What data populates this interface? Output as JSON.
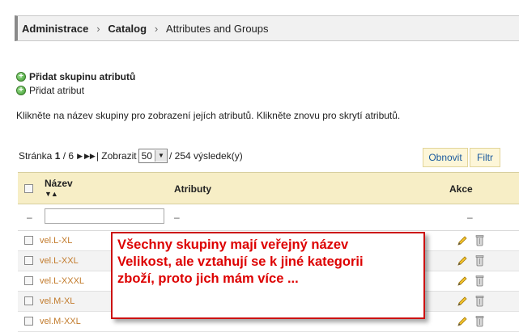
{
  "breadcrumb": {
    "items": [
      "Administrace",
      "Catalog",
      "Attributes and Groups"
    ],
    "separator": "›"
  },
  "actions": {
    "add_group": "Přidat skupinu atributů",
    "add_attribute": "Přidat atribut"
  },
  "info_text": "Klikněte na název skupiny pro zobrazení jejích atributů. Klikněte znovu pro skrytí atributů.",
  "pager": {
    "page_label": "Stránka",
    "page_current": "1",
    "page_total": "/ 6",
    "show_label": "| Zobrazit",
    "per_page": "50",
    "results": "/ 254 výsledek(y)"
  },
  "buttons": {
    "refresh": "Obnovit",
    "filter": "Filtr"
  },
  "table": {
    "columns": {
      "name": "Název",
      "attributes": "Atributy",
      "actions": "Akce"
    },
    "filter_placeholder": "–",
    "rows": [
      {
        "name": "vel.L-XL"
      },
      {
        "name": "vel.L-XXL"
      },
      {
        "name": "vel.L-XXXL"
      },
      {
        "name": "vel.M-XL"
      },
      {
        "name": "vel.M-XXL"
      }
    ]
  },
  "annotation": {
    "lines": [
      "Všechny skupiny mají veřejný název",
      "Velikost, ale vztahují se k jiné kategorii",
      "zboží, proto jich mám více ..."
    ],
    "color": "#dd0000"
  },
  "colors": {
    "header_bg": "#f7eec6",
    "link": "#c27b2c",
    "button_text": "#1a5a9e"
  }
}
